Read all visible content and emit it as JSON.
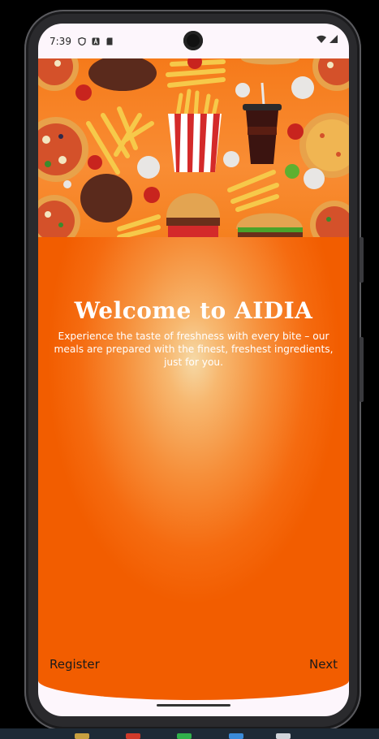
{
  "status_bar": {
    "time": "7:39"
  },
  "onboarding": {
    "title": "Welcome to AIDIA",
    "subtitle": "Experience the taste of freshness with every bite – our meals are prepared with the finest, freshest ingredients, just for you.",
    "register_label": "Register",
    "next_label": "Next"
  },
  "colors": {
    "background_orange": "#f25d00",
    "center_glow": "#f6d9a6",
    "text": "#ffffff"
  },
  "icons": [
    "shield-icon",
    "a-badge-icon",
    "sd-card-icon",
    "wifi-icon",
    "signal-icon",
    "camera-punch-hole"
  ]
}
